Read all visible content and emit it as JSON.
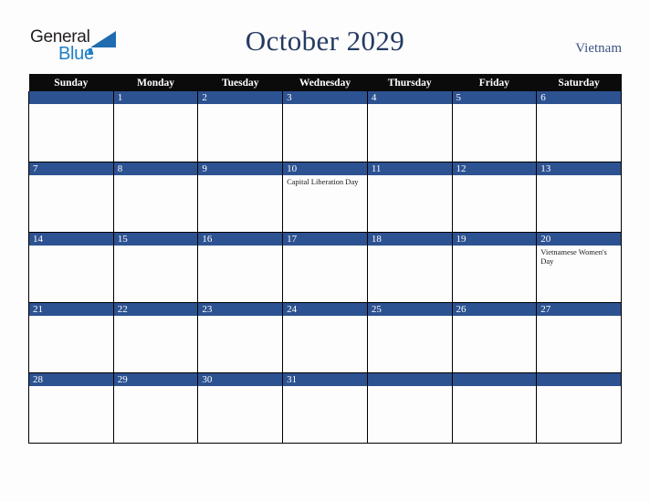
{
  "brand": {
    "name_part1": "General",
    "name_part2": "Blue",
    "triangle_icon": "triangle-icon",
    "color_dark": "#231f20",
    "color_blue": "#1f7fc4"
  },
  "header": {
    "title": "October 2029",
    "country": "Vietnam",
    "title_color": "#243a63"
  },
  "calendar": {
    "accent_color": "#2d5291",
    "header_bg": "#0b0b0b",
    "weekdays": [
      "Sunday",
      "Monday",
      "Tuesday",
      "Wednesday",
      "Thursday",
      "Friday",
      "Saturday"
    ],
    "weeks": [
      [
        {
          "day": "",
          "events": []
        },
        {
          "day": "1",
          "events": []
        },
        {
          "day": "2",
          "events": []
        },
        {
          "day": "3",
          "events": []
        },
        {
          "day": "4",
          "events": []
        },
        {
          "day": "5",
          "events": []
        },
        {
          "day": "6",
          "events": []
        }
      ],
      [
        {
          "day": "7",
          "events": []
        },
        {
          "day": "8",
          "events": []
        },
        {
          "day": "9",
          "events": []
        },
        {
          "day": "10",
          "events": [
            "Capital Liberation Day"
          ]
        },
        {
          "day": "11",
          "events": []
        },
        {
          "day": "12",
          "events": []
        },
        {
          "day": "13",
          "events": []
        }
      ],
      [
        {
          "day": "14",
          "events": []
        },
        {
          "day": "15",
          "events": []
        },
        {
          "day": "16",
          "events": []
        },
        {
          "day": "17",
          "events": []
        },
        {
          "day": "18",
          "events": []
        },
        {
          "day": "19",
          "events": []
        },
        {
          "day": "20",
          "events": [
            "Vietnamese Women's Day"
          ]
        }
      ],
      [
        {
          "day": "21",
          "events": []
        },
        {
          "day": "22",
          "events": []
        },
        {
          "day": "23",
          "events": []
        },
        {
          "day": "24",
          "events": []
        },
        {
          "day": "25",
          "events": []
        },
        {
          "day": "26",
          "events": []
        },
        {
          "day": "27",
          "events": []
        }
      ],
      [
        {
          "day": "28",
          "events": []
        },
        {
          "day": "29",
          "events": []
        },
        {
          "day": "30",
          "events": []
        },
        {
          "day": "31",
          "events": []
        },
        {
          "day": "",
          "events": []
        },
        {
          "day": "",
          "events": []
        },
        {
          "day": "",
          "events": []
        }
      ]
    ]
  }
}
